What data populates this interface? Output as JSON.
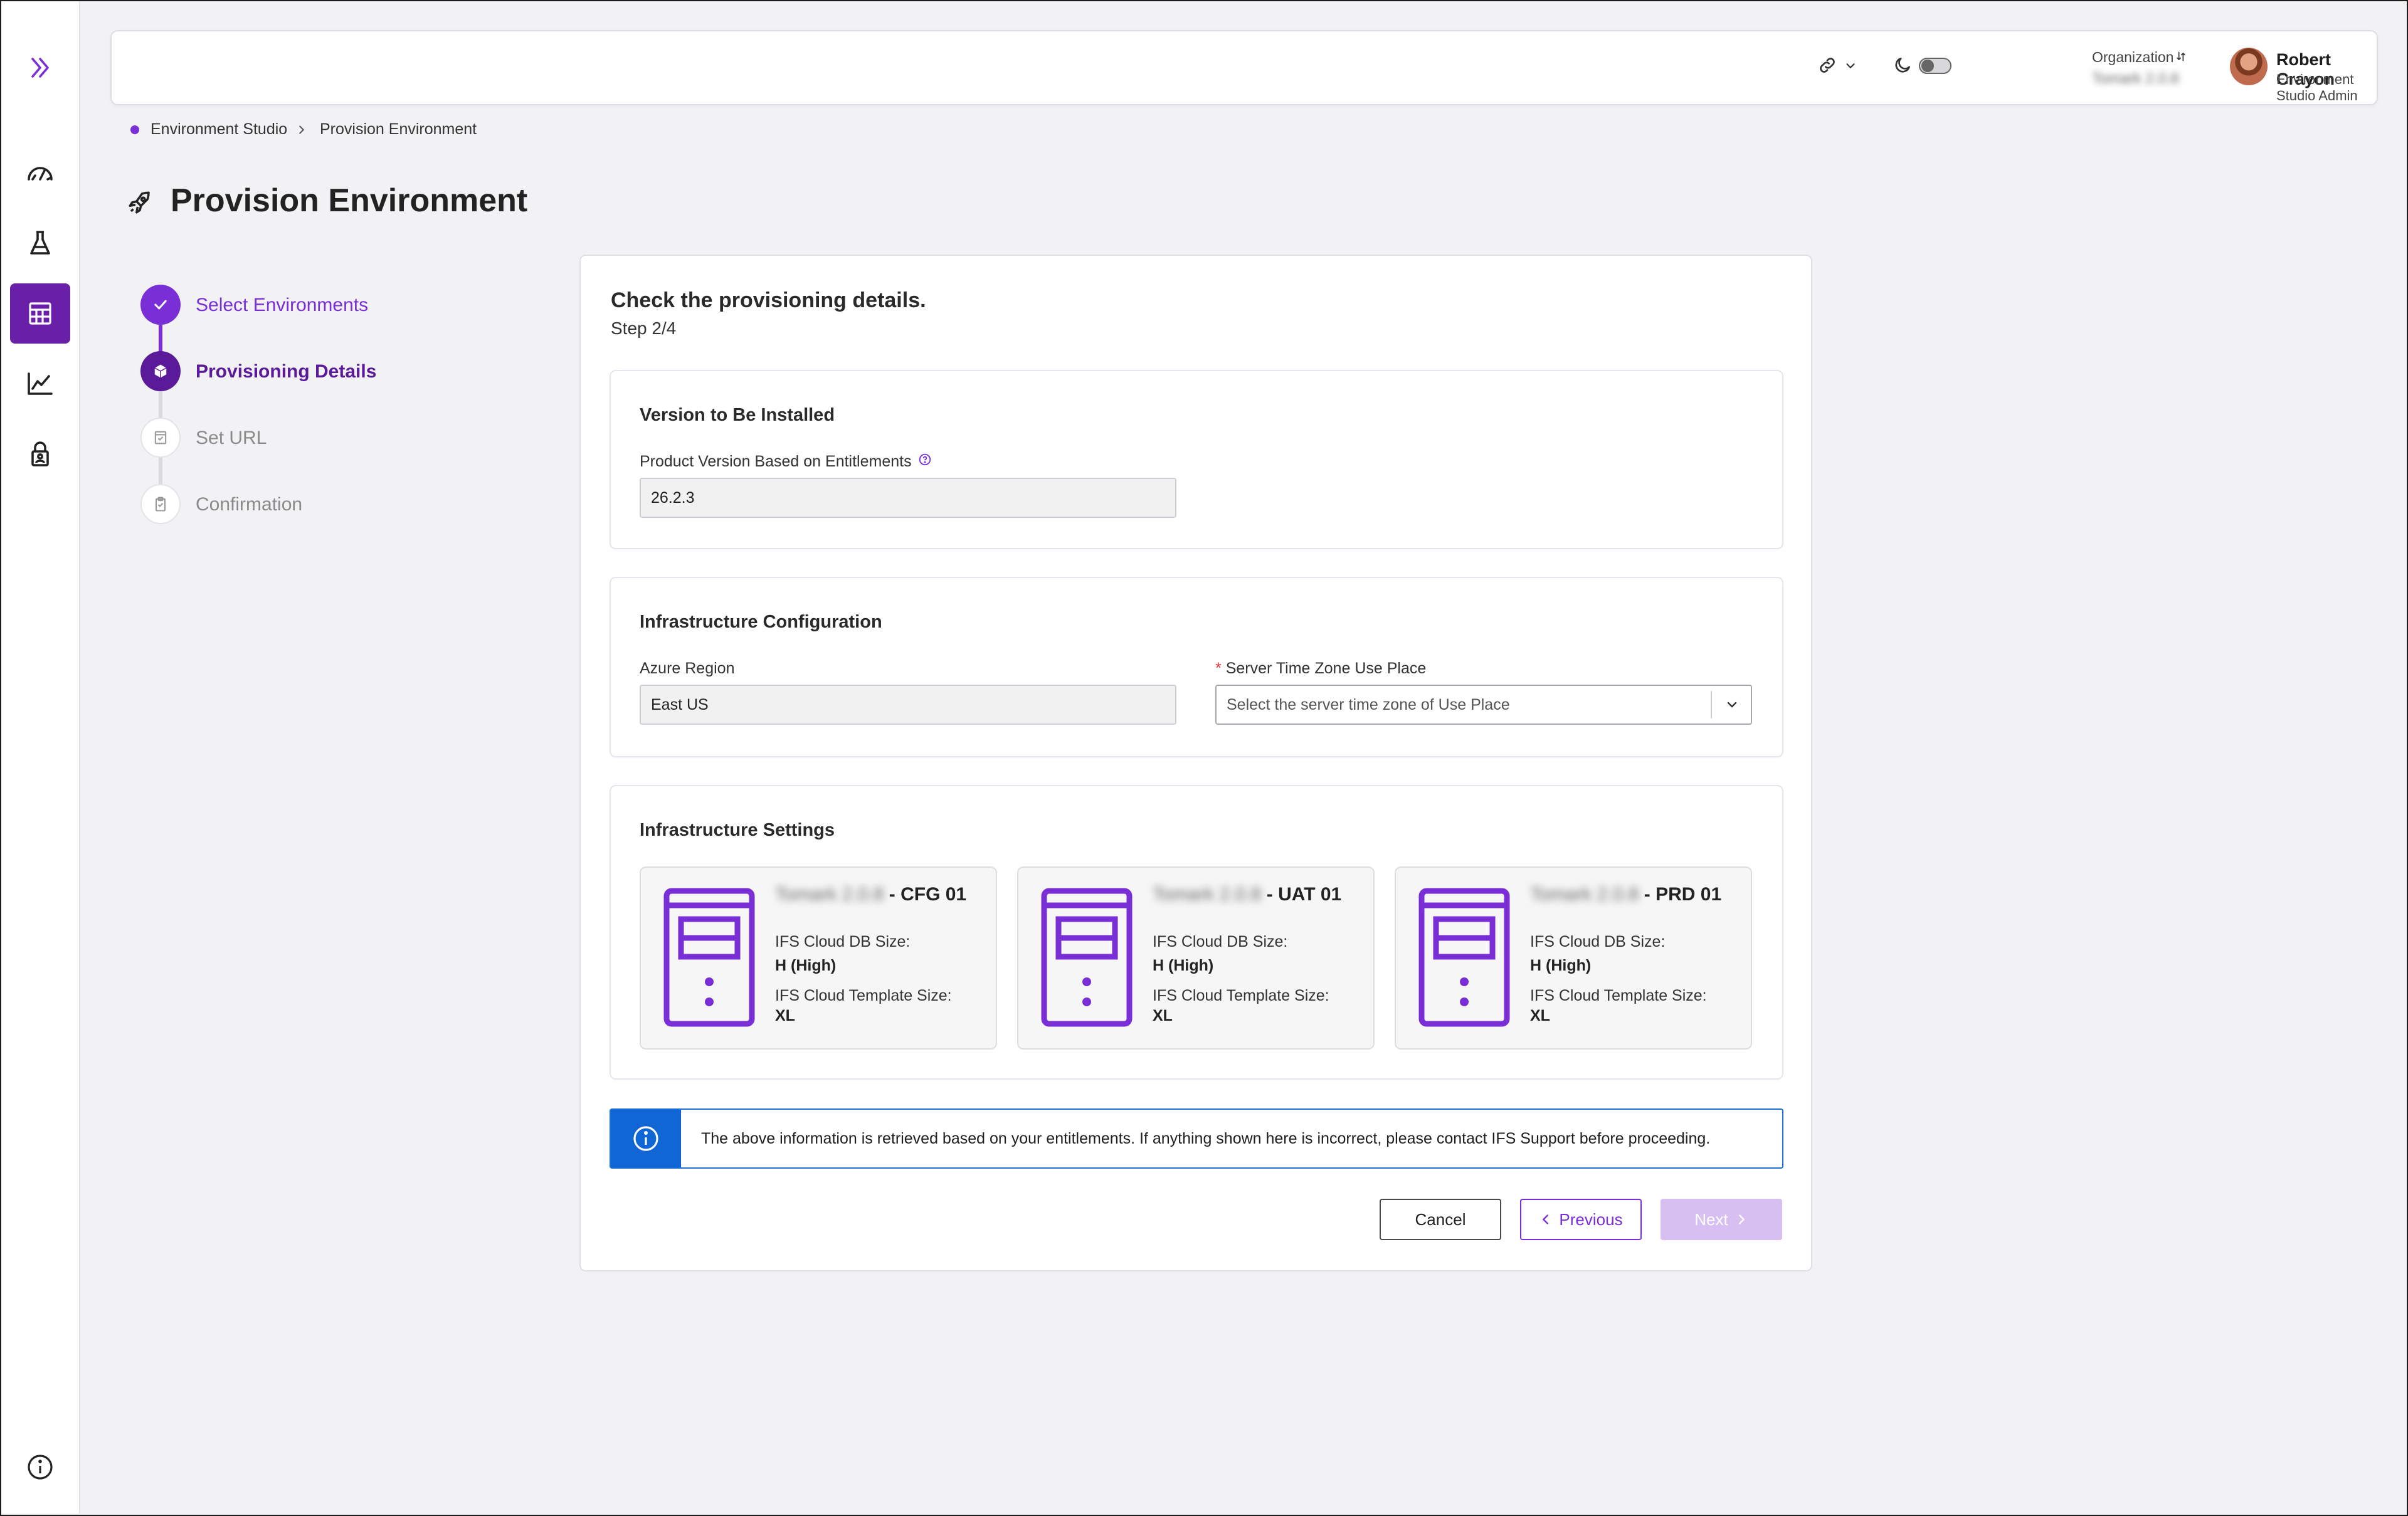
{
  "app": {
    "accent_color": "#7a2ed6",
    "dark_accent_color": "#5b1a9a",
    "info_color": "#0f66d4"
  },
  "rail": {
    "items": [
      {
        "icon": "chevrons-right-icon"
      },
      {
        "icon": "gauge-icon"
      },
      {
        "icon": "flask-icon"
      },
      {
        "icon": "grid-calendar-icon",
        "active": true
      },
      {
        "icon": "line-chart-icon"
      },
      {
        "icon": "lock-person-icon"
      },
      {
        "icon": "info-icon"
      }
    ]
  },
  "header": {
    "organization_label": "Organization",
    "organization_value": "Tomark 2.0.8",
    "user_name": "Robert Crayon",
    "user_role": "Environment Studio Admin"
  },
  "breadcrumb": {
    "root": "Environment Studio",
    "current": "Provision Environment"
  },
  "page": {
    "title": "Provision Environment"
  },
  "stepper": {
    "steps": [
      {
        "label": "Select Environments",
        "state": "done"
      },
      {
        "label": "Provisioning Details",
        "state": "active"
      },
      {
        "label": "Set URL",
        "state": "pending"
      },
      {
        "label": "Confirmation",
        "state": "pending"
      }
    ]
  },
  "card": {
    "title": "Check the provisioning details.",
    "step": "Step 2/4"
  },
  "version": {
    "section_title": "Version to Be Installed",
    "field_label": "Product Version Based on Entitlements",
    "field_value": "26.2.3"
  },
  "infra_config": {
    "section_title": "Infrastructure Configuration",
    "region_label": "Azure Region",
    "region_value": "East US",
    "required_mark": "*",
    "timezone_label": "Server Time Zone Use Place",
    "timezone_placeholder": "Select the server time zone of Use Place"
  },
  "infra_settings": {
    "section_title": "Infrastructure Settings",
    "environments": [
      {
        "prefix": "Tomark 2.0.8",
        "suffix": "- CFG 01",
        "db_label": "IFS Cloud DB Size:",
        "db_value": "H (High)",
        "tpl_label": "IFS Cloud Template Size:",
        "tpl_value": "XL"
      },
      {
        "prefix": "Tomark 2.0.8",
        "suffix": "- UAT 01",
        "db_label": "IFS Cloud DB Size:",
        "db_value": "H (High)",
        "tpl_label": "IFS Cloud Template Size:",
        "tpl_value": "XL"
      },
      {
        "prefix": "Tomark 2.0.8",
        "suffix": "- PRD 01",
        "db_label": "IFS Cloud DB Size:",
        "db_value": "H (High)",
        "tpl_label": "IFS Cloud Template Size:",
        "tpl_value": "XL"
      }
    ]
  },
  "info_banner": {
    "text": "The above information is retrieved based on your entitlements. If anything shown here is incorrect, please contact IFS Support before proceeding."
  },
  "buttons": {
    "cancel": "Cancel",
    "previous": "Previous",
    "next": "Next"
  }
}
